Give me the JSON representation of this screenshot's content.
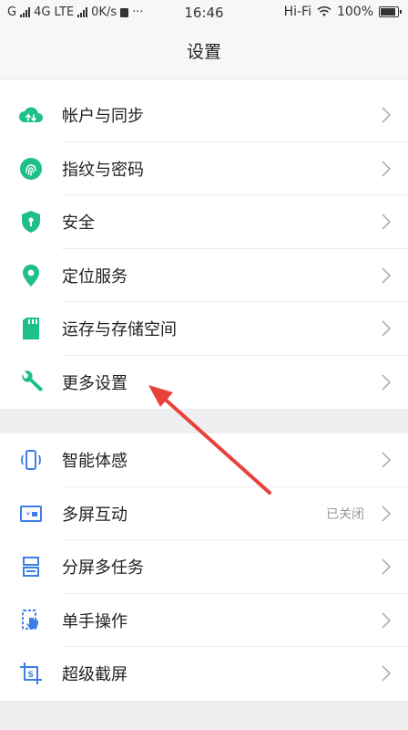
{
  "status_bar": {
    "carrier": "G",
    "network": "4G LTE",
    "speed": "0K/s",
    "more": "···",
    "time": "16:46",
    "wifi": "Hi-Fi",
    "battery": "100%"
  },
  "header": {
    "title": "设置"
  },
  "group1": [
    {
      "label": "帐户与同步",
      "icon": "cloud-sync-icon"
    },
    {
      "label": "指纹与密码",
      "icon": "fingerprint-icon"
    },
    {
      "label": "安全",
      "icon": "shield-icon"
    },
    {
      "label": "定位服务",
      "icon": "location-pin-icon"
    },
    {
      "label": "运存与存储空间",
      "icon": "sd-card-icon"
    },
    {
      "label": "更多设置",
      "icon": "wrench-icon"
    }
  ],
  "group2": [
    {
      "label": "智能体感",
      "icon": "phone-motion-icon",
      "value": ""
    },
    {
      "label": "多屏互动",
      "icon": "screen-cast-icon",
      "value": "已关闭"
    },
    {
      "label": "分屏多任务",
      "icon": "split-screen-icon",
      "value": ""
    },
    {
      "label": "单手操作",
      "icon": "one-hand-icon",
      "value": ""
    },
    {
      "label": "超级截屏",
      "icon": "screenshot-icon",
      "value": ""
    }
  ],
  "colors": {
    "green": "#1dbf8a",
    "blue": "#3d7ee6",
    "arrow": "#e8413a"
  }
}
